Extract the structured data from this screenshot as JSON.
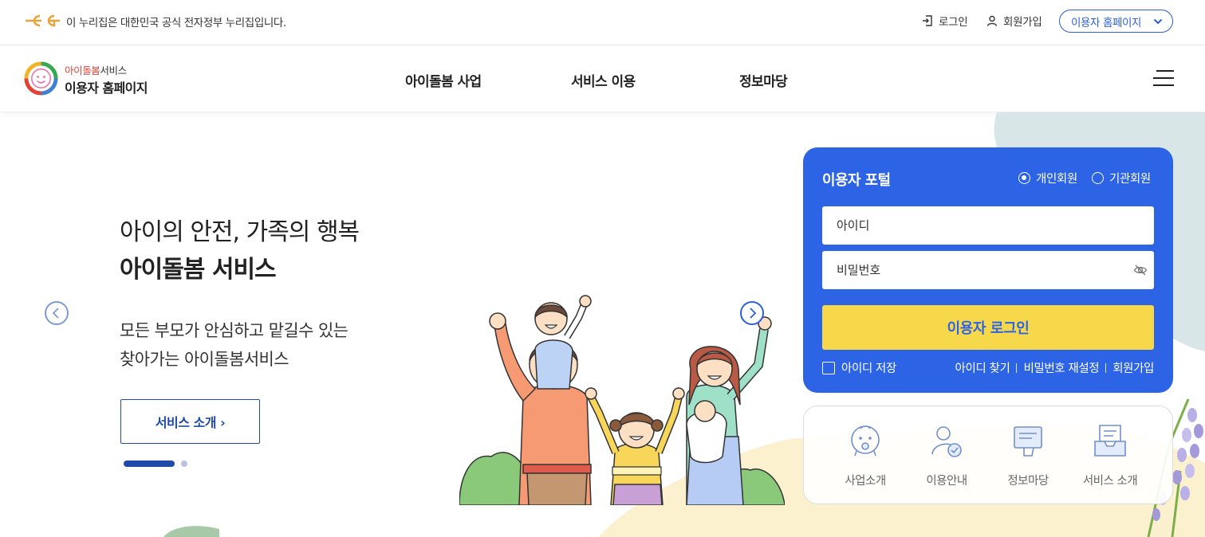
{
  "gov_banner": {
    "text": "이 누리집은 대한민국 공식 전자정부 누리집입니다.",
    "login_label": "로그인",
    "signup_label": "회원가입",
    "home_select_label": "이용자 홈페이지"
  },
  "header": {
    "site_sub_accent": "아이돌봄",
    "site_sub_rest": "서비스",
    "site_name": "이용자 홈페이지",
    "nav": [
      "아이돌봄 사업",
      "서비스 이용",
      "정보마당"
    ]
  },
  "hero": {
    "line1": "아이의 안전, 가족의 행복",
    "line2": "아이돌봄 서비스",
    "desc1": "모든 부모가 안심하고 맡길수 있는",
    "desc2": "찾아가는 아이돌봄서비스",
    "button_label": "서비스 소개 ›",
    "slides_total": 2,
    "slide_current": 1
  },
  "login": {
    "title": "이용자 포털",
    "radio_personal": "개인회원",
    "radio_org": "기관회원",
    "radio_selected": "개인회원",
    "id_placeholder": "아이디",
    "pw_placeholder": "비밀번호",
    "login_button": "이용자 로그인",
    "save_id": "아이디 저장",
    "links": [
      "아이디 찾기",
      "비밀번호 재설정",
      "회원가입"
    ]
  },
  "quick_menu": [
    {
      "label": "사업소개",
      "icon": "baby-face-icon"
    },
    {
      "label": "이용안내",
      "icon": "user-check-icon"
    },
    {
      "label": "정보마당",
      "icon": "document-hand-icon"
    },
    {
      "label": "서비스 소개",
      "icon": "inbox-tray-icon"
    }
  ],
  "colors": {
    "primary": "#2d64e6",
    "navy": "#1f4aa8",
    "login_button": "#f6d84a",
    "logo_accent": "#e0433a"
  }
}
